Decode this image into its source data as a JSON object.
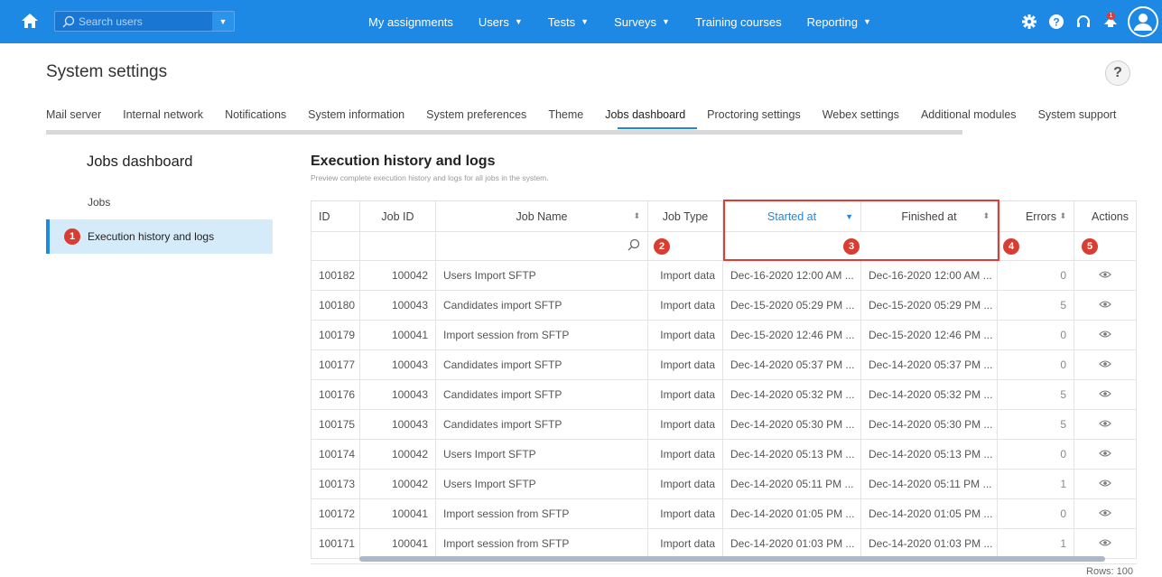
{
  "topbar": {
    "search_placeholder": "Search users",
    "nav": [
      {
        "label": "My assignments",
        "caret": false
      },
      {
        "label": "Users",
        "caret": true
      },
      {
        "label": "Tests",
        "caret": true
      },
      {
        "label": "Surveys",
        "caret": true
      },
      {
        "label": "Training courses",
        "caret": false
      },
      {
        "label": "Reporting",
        "caret": true
      }
    ],
    "notification_count": "1"
  },
  "page": {
    "title": "System settings",
    "help": "?"
  },
  "tabs": [
    "Mail server",
    "Internal network",
    "Notifications",
    "System information",
    "System preferences",
    "Theme",
    "Jobs dashboard",
    "Proctoring settings",
    "Webex settings",
    "Additional modules",
    "System support"
  ],
  "active_tab": "Jobs dashboard",
  "sidebar": {
    "title": "Jobs dashboard",
    "items": [
      {
        "label": "Jobs"
      },
      {
        "label": "Execution history and logs",
        "badge": "1"
      }
    ]
  },
  "main": {
    "title": "Execution history and logs",
    "subtitle": "Preview complete execution history and logs for all jobs in the system."
  },
  "table": {
    "columns": [
      "ID",
      "Job ID",
      "Job Name",
      "Job Type",
      "Started at",
      "Finished at",
      "Errors",
      "Actions"
    ],
    "filter_badges": {
      "job_type": "2",
      "started": "3",
      "errors": "4",
      "actions": "5"
    },
    "rows": [
      {
        "id": "100182",
        "job_id": "100042",
        "name": "Users Import SFTP",
        "type": "Import data",
        "started": "Dec-16-2020 12:00 AM ...",
        "finished": "Dec-16-2020 12:00 AM ...",
        "errors": "0"
      },
      {
        "id": "100180",
        "job_id": "100043",
        "name": "Candidates import SFTP",
        "type": "Import data",
        "started": "Dec-15-2020 05:29 PM ...",
        "finished": "Dec-15-2020 05:29 PM ...",
        "errors": "5"
      },
      {
        "id": "100179",
        "job_id": "100041",
        "name": "Import session from SFTP",
        "type": "Import data",
        "started": "Dec-15-2020 12:46 PM ...",
        "finished": "Dec-15-2020 12:46 PM ...",
        "errors": "0"
      },
      {
        "id": "100177",
        "job_id": "100043",
        "name": "Candidates import SFTP",
        "type": "Import data",
        "started": "Dec-14-2020 05:37 PM ...",
        "finished": "Dec-14-2020 05:37 PM ...",
        "errors": "0"
      },
      {
        "id": "100176",
        "job_id": "100043",
        "name": "Candidates import SFTP",
        "type": "Import data",
        "started": "Dec-14-2020 05:32 PM ...",
        "finished": "Dec-14-2020 05:32 PM ...",
        "errors": "5"
      },
      {
        "id": "100175",
        "job_id": "100043",
        "name": "Candidates import SFTP",
        "type": "Import data",
        "started": "Dec-14-2020 05:30 PM ...",
        "finished": "Dec-14-2020 05:30 PM ...",
        "errors": "5"
      },
      {
        "id": "100174",
        "job_id": "100042",
        "name": "Users Import SFTP",
        "type": "Import data",
        "started": "Dec-14-2020 05:13 PM ...",
        "finished": "Dec-14-2020 05:13 PM ...",
        "errors": "0"
      },
      {
        "id": "100173",
        "job_id": "100042",
        "name": "Users Import SFTP",
        "type": "Import data",
        "started": "Dec-14-2020 05:11 PM ...",
        "finished": "Dec-14-2020 05:11 PM ...",
        "errors": "1"
      },
      {
        "id": "100172",
        "job_id": "100041",
        "name": "Import session from SFTP",
        "type": "Import data",
        "started": "Dec-14-2020 01:05 PM ...",
        "finished": "Dec-14-2020 01:05 PM ...",
        "errors": "0"
      },
      {
        "id": "100171",
        "job_id": "100041",
        "name": "Import session from SFTP",
        "type": "Import data",
        "started": "Dec-14-2020 01:03 PM ...",
        "finished": "Dec-14-2020 01:03 PM ...",
        "errors": "1"
      }
    ]
  },
  "pager": {
    "text": "Rows: 100"
  },
  "colors": {
    "brand": "#1e88e5",
    "highlight": "#e53935",
    "active_side": "#d6ebfa"
  }
}
